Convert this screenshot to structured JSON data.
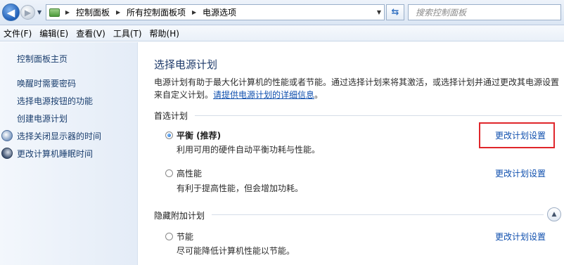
{
  "address_bar": {
    "breadcrumbs": [
      "控制面板",
      "所有控制面板项",
      "电源选项"
    ],
    "search_placeholder": "搜索控制面板"
  },
  "menu": [
    "文件(F)",
    "编辑(E)",
    "查看(V)",
    "工具(T)",
    "帮助(H)"
  ],
  "sidebar": {
    "home": "控制面板主页",
    "links": [
      {
        "label": "唤醒时需要密码",
        "icon": ""
      },
      {
        "label": "选择电源按钮的功能",
        "icon": ""
      },
      {
        "label": "创建电源计划",
        "icon": ""
      },
      {
        "label": "选择关闭显示器的时间",
        "icon": "monitor-icon"
      },
      {
        "label": "更改计算机睡眠时间",
        "icon": "moon-icon"
      }
    ]
  },
  "main": {
    "title": "选择电源计划",
    "intro_text": "电源计划有助于最大化计算机的性能或者节能。通过选择计划来将其激活，或选择计划并通过更改其电源设置来自定义计划。",
    "intro_link": "请提供电源计划的详细信息",
    "intro_end": "。",
    "preferred_group": "首选计划",
    "hidden_group": "隐藏附加计划",
    "plans": [
      {
        "name": "平衡 (推荐)",
        "description": "利用可用的硬件自动平衡功耗与性能。",
        "selected": true,
        "link": "更改计划设置"
      },
      {
        "name": "高性能",
        "description": "有利于提高性能，但会增加功耗。",
        "selected": false,
        "link": "更改计划设置"
      },
      {
        "name": "节能",
        "description": "尽可能降低计算机性能以节能。",
        "selected": false,
        "link": "更改计划设置"
      }
    ]
  }
}
